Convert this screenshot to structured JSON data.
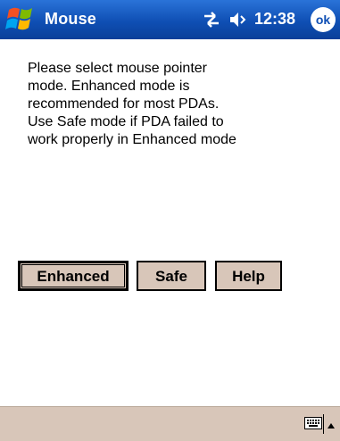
{
  "titlebar": {
    "app_title": "Mouse",
    "clock": "12:38",
    "ok_label": "ok",
    "icons": [
      "windows-start-icon",
      "connectivity-icon",
      "volume-icon"
    ]
  },
  "content": {
    "instructions": "Please select mouse pointer\nmode. Enhanced mode is\nrecommended for most PDAs.\nUse Safe mode if PDA failed to\nwork properly in Enhanced mode"
  },
  "buttons": {
    "enhanced": "Enhanced",
    "safe": "Safe",
    "help": "Help"
  },
  "bottombar": {
    "icons": [
      "keyboard-icon",
      "input-panel-arrow-icon"
    ]
  },
  "colors": {
    "titlebar": "#0f4fb4",
    "button_face": "#d8c6b9",
    "bottombar": "#d8c6b9"
  }
}
